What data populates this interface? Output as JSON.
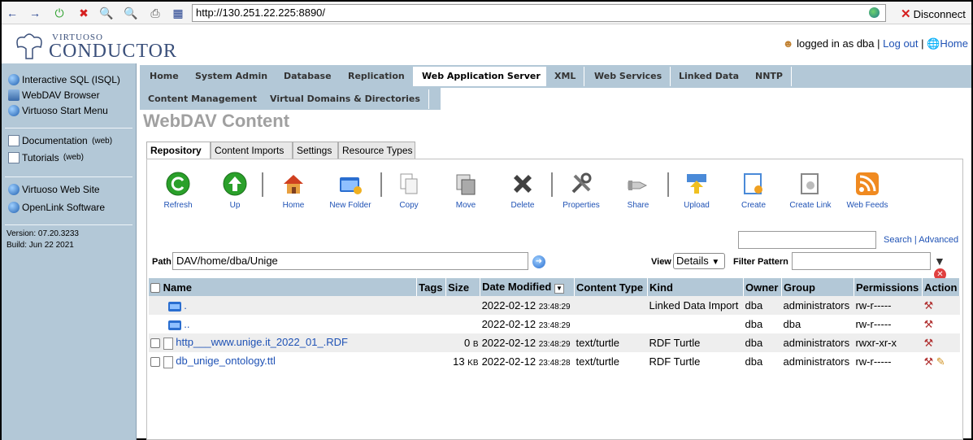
{
  "browser": {
    "url": "http://130.251.22.225:8890/",
    "disconnect": "Disconnect"
  },
  "header": {
    "logo_small": "VIRTUOSO",
    "logo_big": "CONDUCTOR",
    "logged_in": "logged in as dba",
    "logout": "Log out",
    "home": "Home"
  },
  "sidebar": {
    "group1": [
      {
        "label": "Interactive SQL (ISQL)",
        "icon": "isql-icon"
      },
      {
        "label": "WebDAV Browser",
        "icon": "webdav-icon"
      },
      {
        "label": "Virtuoso Start Menu",
        "icon": "start-menu-icon"
      }
    ],
    "group2": [
      {
        "label": "Documentation",
        "suffix": "(web)",
        "icon": "documentation-icon"
      },
      {
        "label": "Tutorials",
        "suffix": "(web)",
        "icon": "tutorials-icon"
      }
    ],
    "group3": [
      {
        "label": "Virtuoso Web Site",
        "icon": "virtuoso-site-icon"
      },
      {
        "label": "OpenLink Software",
        "icon": "openlink-icon"
      }
    ],
    "version": "Version: 07.20.3233",
    "build": "Build: Jun 22 2021"
  },
  "tabs": [
    "Home",
    "System Admin",
    "Database",
    "Replication",
    "Web Application Server",
    "XML",
    "Web Services",
    "Linked Data",
    "NNTP"
  ],
  "subnav": [
    "Content Management",
    "Virtual Domains & Directories"
  ],
  "page_title": "WebDAV Content",
  "subtabs": [
    "Repository",
    "Content Imports",
    "Settings",
    "Resource Types"
  ],
  "toolbar": [
    {
      "label": "Refresh",
      "icon": "refresh-icon",
      "color": "#2aa02a"
    },
    {
      "label": "Up",
      "icon": "up-icon",
      "color": "#2aa02a"
    },
    {
      "label": "Home",
      "icon": "home-icon",
      "color": "#d06020"
    },
    {
      "label": "New Folder",
      "icon": "new-folder-icon",
      "color": "#2a6ed0"
    },
    {
      "label": "Copy",
      "icon": "copy-icon",
      "color": "#c0c0c0"
    },
    {
      "label": "Move",
      "icon": "move-icon",
      "color": "#909090"
    },
    {
      "label": "Delete",
      "icon": "delete-icon",
      "color": "#404040"
    },
    {
      "label": "Properties",
      "icon": "properties-icon",
      "color": "#606060"
    },
    {
      "label": "Share",
      "icon": "share-icon",
      "color": "#a0a0a0"
    },
    {
      "label": "Upload",
      "icon": "upload-icon",
      "color": "#4a8ad8"
    },
    {
      "label": "Create",
      "icon": "create-icon",
      "color": "#4a8ad8"
    },
    {
      "label": "Create Link",
      "icon": "create-link-icon",
      "color": "#909090"
    },
    {
      "label": "Web Feeds",
      "icon": "web-feeds-icon",
      "color": "#f08a20"
    }
  ],
  "search": {
    "search": "Search",
    "advanced": "Advanced"
  },
  "path": {
    "label": "Path",
    "value": "DAV/home/dba/Unige"
  },
  "view": {
    "label": "View",
    "value": "Details"
  },
  "filter": {
    "label": "Filter Pattern"
  },
  "table": {
    "headers": [
      "Name",
      "Tags",
      "Size",
      "Date Modified",
      "Content Type",
      "Kind",
      "Owner",
      "Group",
      "Permissions",
      "Action"
    ],
    "rows": [
      {
        "name": ".",
        "type": "folder",
        "size": "",
        "unit": "",
        "date": "2022-02-12",
        "time": "23:48:29",
        "content_type": "",
        "kind": "Linked Data Import",
        "owner": "dba",
        "group": "administrators",
        "perms": "rw-r-----"
      },
      {
        "name": "..",
        "type": "folder",
        "size": "",
        "unit": "",
        "date": "2022-02-12",
        "time": "23:48:29",
        "content_type": "",
        "kind": "",
        "owner": "dba",
        "group": "dba",
        "perms": "rw-r-----"
      },
      {
        "name": "http___www.unige.it_2022_01_.RDF",
        "type": "file",
        "size": "0",
        "unit": "B",
        "date": "2022-02-12",
        "time": "23:48:29",
        "content_type": "text/turtle",
        "kind": "RDF Turtle",
        "owner": "dba",
        "group": "administrators",
        "perms": "rwxr-xr-x"
      },
      {
        "name": "db_unige_ontology.ttl",
        "type": "file",
        "size": "13",
        "unit": "KB",
        "date": "2022-02-12",
        "time": "23:48:28",
        "content_type": "text/turtle",
        "kind": "RDF Turtle",
        "owner": "dba",
        "group": "administrators",
        "perms": "rw-r-----"
      }
    ]
  }
}
